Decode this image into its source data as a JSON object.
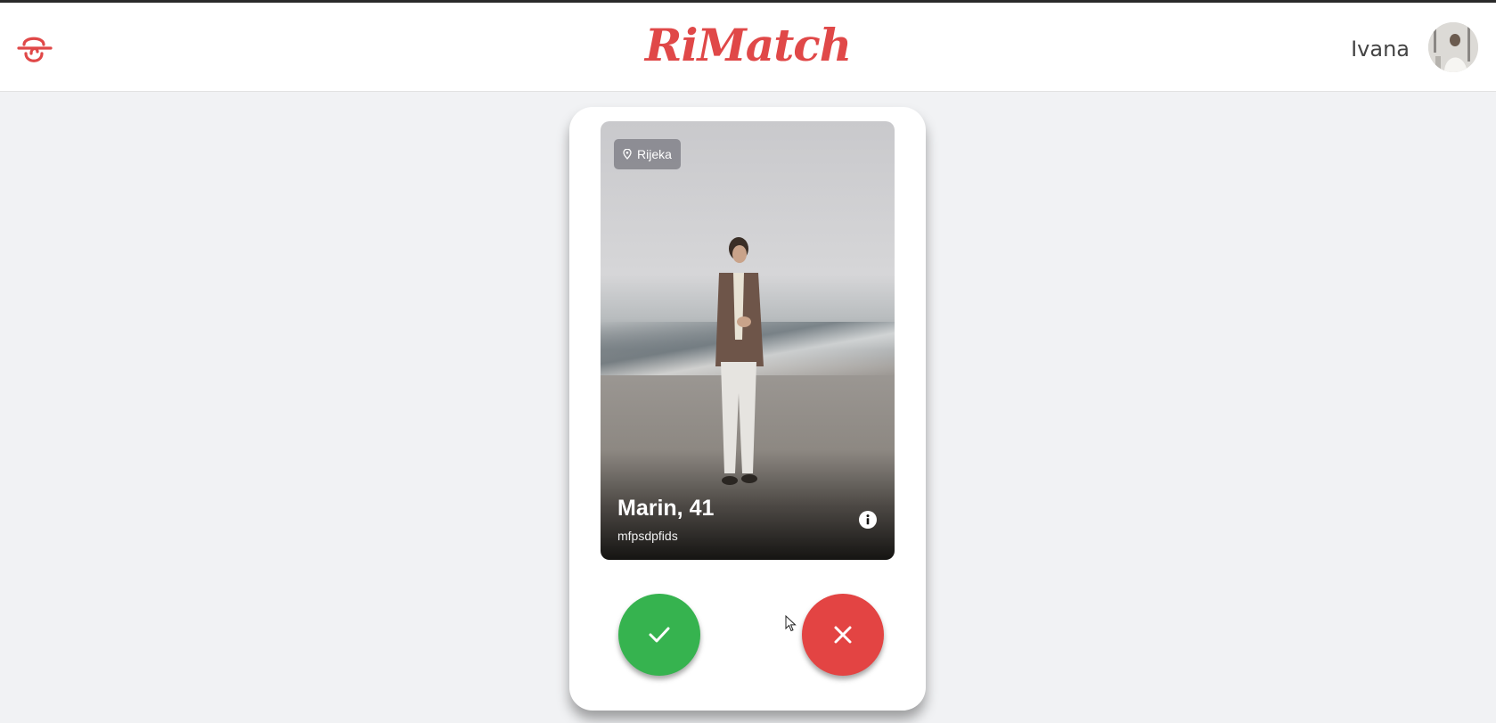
{
  "header": {
    "brand": "RiMatch",
    "menu_icon": "logo-menu-icon",
    "username": "Ivana",
    "avatar_icon": "user-avatar"
  },
  "profile": {
    "location": "Rijeka",
    "location_icon": "map-pin-icon",
    "name_age": "Marin, 41",
    "bio": "mfpsdpfids",
    "info_icon": "info-icon"
  },
  "actions": {
    "like_icon": "check-icon",
    "dislike_icon": "close-icon"
  },
  "colors": {
    "brand": "#e04848",
    "like": "#36b34f",
    "dislike": "#e34443",
    "background": "#f1f2f4"
  }
}
